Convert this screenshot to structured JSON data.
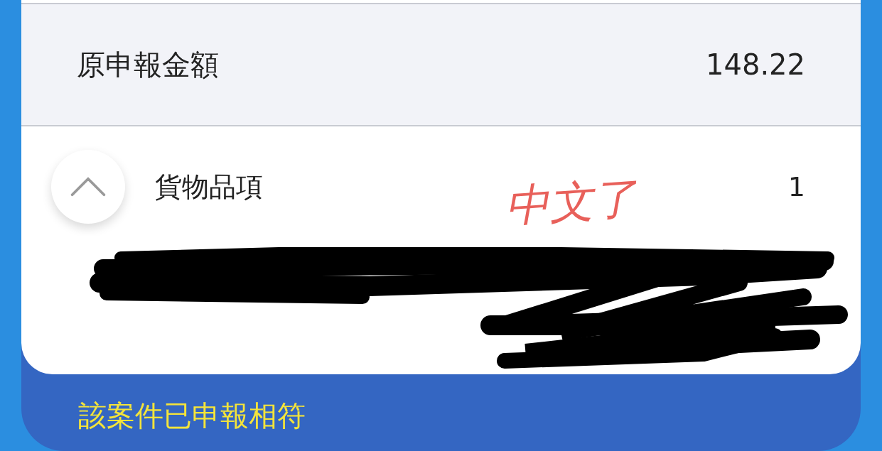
{
  "summary_row": {
    "label": "原申報金額",
    "value": "148.22"
  },
  "items_section": {
    "label": "貨物品項",
    "count": "1",
    "expanded": true
  },
  "annotation": {
    "text": "中文了"
  },
  "status_message": "該案件已申報相符"
}
